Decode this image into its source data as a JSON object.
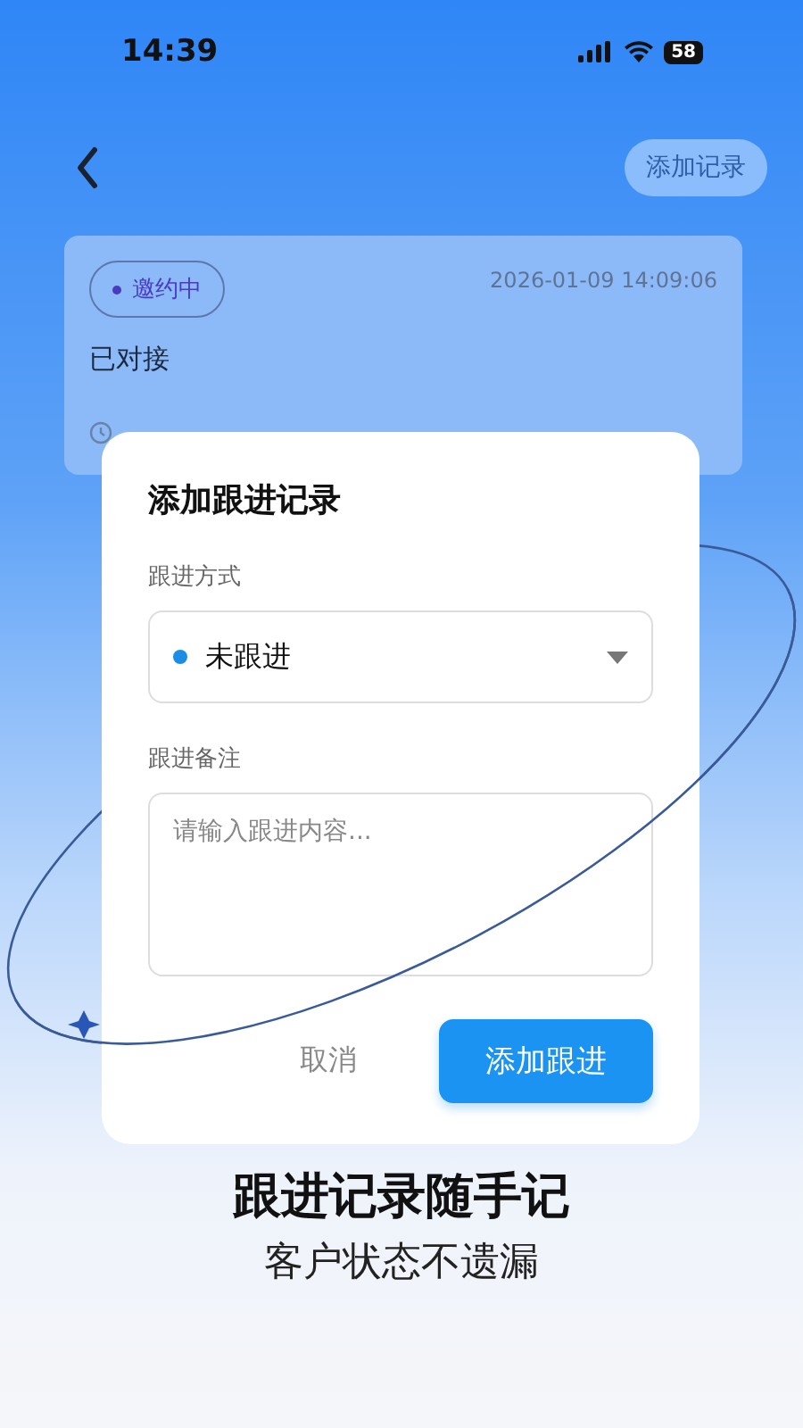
{
  "status_bar": {
    "time": "14:39",
    "battery": "58"
  },
  "header": {
    "action": "添加记录"
  },
  "record": {
    "status": "邀约中",
    "datetime": "2026-01-09 14:09:06",
    "content": "已对接"
  },
  "dialog": {
    "title": "添加跟进记录",
    "method_label": "跟进方式",
    "method_value": "未跟进",
    "note_label": "跟进备注",
    "note_placeholder": "请输入跟进内容...",
    "buttons": [
      {
        "label": "取消",
        "kind": "text"
      },
      {
        "label": "添加跟进",
        "kind": "primary"
      }
    ]
  },
  "tagline": {
    "title": "跟进记录随手记",
    "subtitle": "客户状态不遗漏"
  }
}
